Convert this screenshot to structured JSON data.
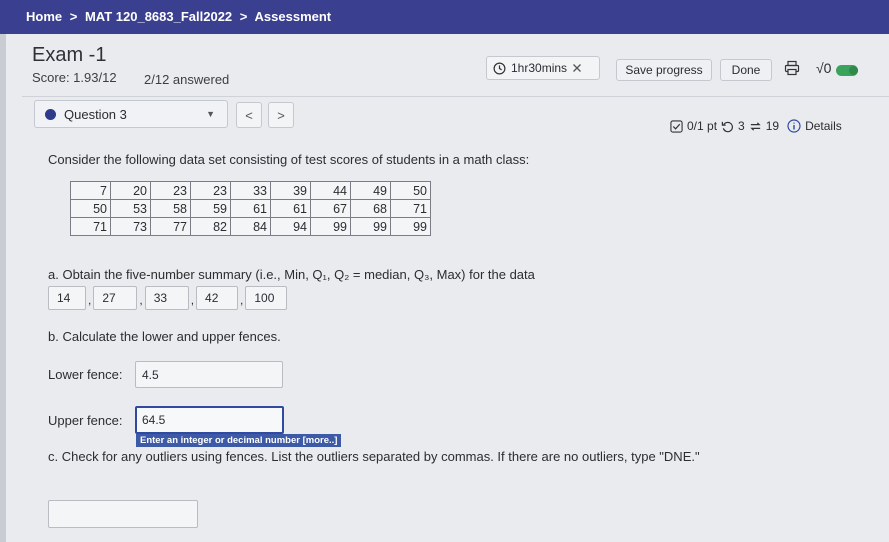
{
  "breadcrumb": {
    "home": "Home",
    "sep1": ">",
    "course": "MAT 120_8683_Fall2022",
    "sep2": ">",
    "current": "Assessment"
  },
  "header": {
    "title": "Exam -1",
    "score": "Score: 1.93/12",
    "answered": "2/12 answered",
    "timer": "1hr30mins",
    "save_label": "Save progress",
    "done_label": "Done",
    "sqrt_label": "√0"
  },
  "question_nav": {
    "selected": "Question 3",
    "prev": "<",
    "next": ">"
  },
  "question_meta": {
    "points": "0/1 pt",
    "attempts": "3",
    "retries": "19",
    "details": "Details"
  },
  "question": {
    "prompt": "Consider the following data set consisting of test scores of students in a math class:",
    "table": [
      [
        "7",
        "20",
        "23",
        "23",
        "33",
        "39",
        "44",
        "49",
        "50"
      ],
      [
        "50",
        "53",
        "58",
        "59",
        "61",
        "61",
        "67",
        "68",
        "71"
      ],
      [
        "71",
        "73",
        "77",
        "82",
        "84",
        "94",
        "99",
        "99",
        "99"
      ]
    ],
    "part_a": "a. Obtain the five-number summary (i.e., Min, Q₁, Q₂ = median, Q₃, Max) for the data",
    "five_number": [
      "14",
      "27",
      "33",
      "42",
      "100"
    ],
    "part_b": "b. Calculate the lower and upper fences.",
    "lower_label": "Lower fence:",
    "lower_value": "4.5",
    "upper_label": "Upper fence:",
    "upper_value": "64.5",
    "hint": "Enter an integer or decimal number [more..]",
    "part_c": "c. Check for any outliers using fences. List the outliers separated by commas. If there are no outliers, type \"DNE.\"",
    "part_c_value": ""
  },
  "colors": {
    "topbar": "#3a3f8f",
    "accent": "#2f4aa0",
    "toggle": "#3aa35b"
  }
}
